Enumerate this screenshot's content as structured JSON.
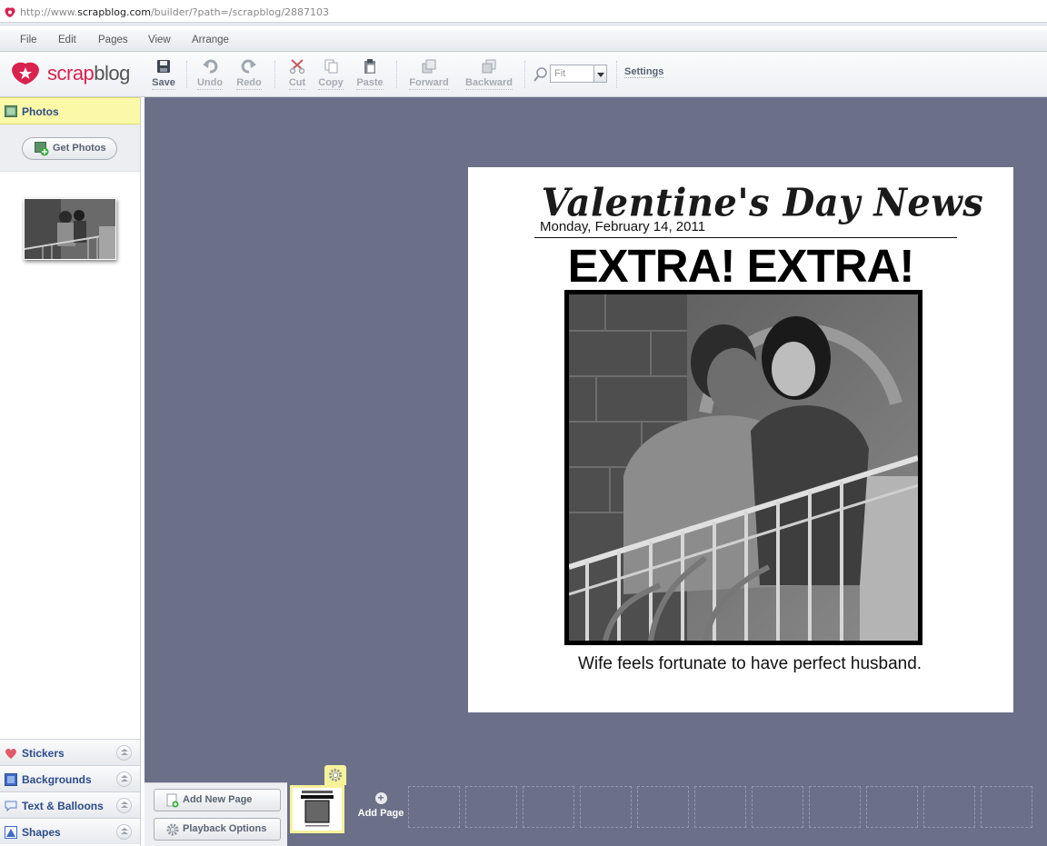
{
  "browser": {
    "url_prefix": "http://www.",
    "url_domain": "scrapblog.com",
    "url_path": "/builder/?path=/scrapblog/2887103"
  },
  "menu": [
    "File",
    "Edit",
    "Pages",
    "View",
    "Arrange"
  ],
  "logo": {
    "brand_part1": "scrap",
    "brand_part2": "blog"
  },
  "toolbar": {
    "save": "Save",
    "undo": "Undo",
    "redo": "Redo",
    "cut": "Cut",
    "copy": "Copy",
    "paste": "Paste",
    "forward": "Forward",
    "backward": "Backward",
    "zoom_value": "Fit",
    "settings": "Settings"
  },
  "left_panel": {
    "photos_tab": "Photos",
    "get_photos": "Get Photos",
    "sections": [
      "Stickers",
      "Backgrounds",
      "Text & Balloons",
      "Shapes"
    ]
  },
  "page": {
    "headline": "Valentine's Day News",
    "date": "Monday, February 14, 2011",
    "banner": "EXTRA! EXTRA!",
    "caption": "Wife feels fortunate to have perfect husband."
  },
  "pages_bar": {
    "add_new_page": "Add New Page",
    "playback_options": "Playback Options",
    "add_page": "Add Page"
  },
  "colors": {
    "workspace": "#6b7088",
    "brand": "#d8234e",
    "photos_tab_bg": "#fbf9a7"
  }
}
